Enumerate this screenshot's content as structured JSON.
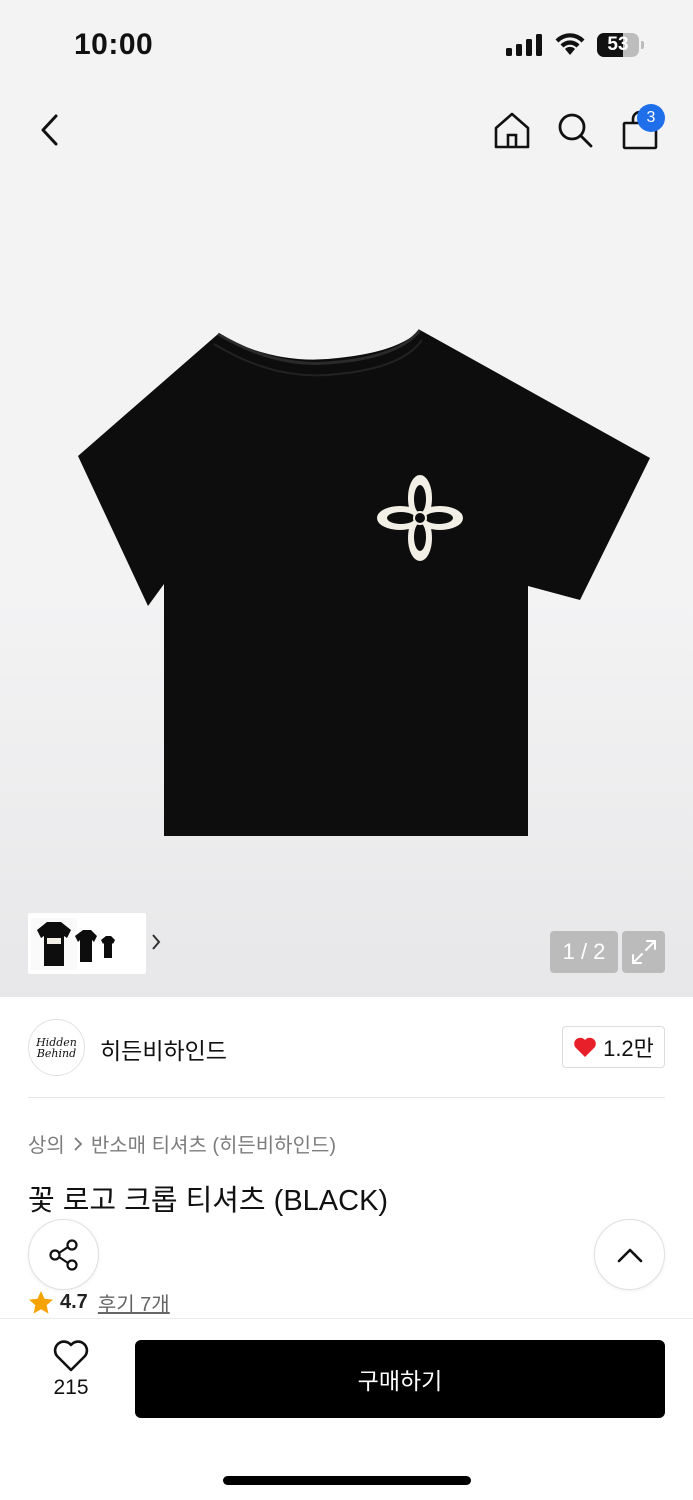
{
  "status_bar": {
    "time": "10:00",
    "battery": "53"
  },
  "header": {
    "icons": [
      "back-arrow-icon",
      "home-icon",
      "search-icon",
      "shopping-bag-icon"
    ],
    "cart_badge": "3"
  },
  "gallery": {
    "counter": "1 / 2",
    "thumbnail_alt": "product thumbnails",
    "colors": {
      "shirt": "#0d0d0d",
      "logo": "#f2efe6"
    }
  },
  "brand": {
    "logo_line1": "Hidden",
    "logo_line2": "Behind",
    "name": "히든비하인드",
    "likes": "1.2만"
  },
  "breadcrumb": {
    "level1": "상의",
    "level2": "반소매 티셔츠 (히든비하인드)"
  },
  "product": {
    "title": "꽃 로고 크롭 티셔츠 (BLACK)",
    "rating": "4.7",
    "reviews": "후기 7개"
  },
  "bottom_bar": {
    "wish_count": "215",
    "buy_label": "구매하기",
    "accent_color": "#000000",
    "heart_color": "#e8202a"
  }
}
